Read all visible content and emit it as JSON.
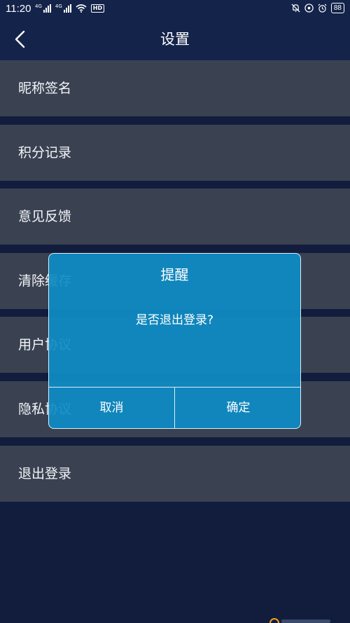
{
  "status_bar": {
    "time": "11:20",
    "signal_1_tag": "4G",
    "signal_2_tag": "4G",
    "hd_label": "HD",
    "battery": "88",
    "icons": [
      "signal-icon",
      "signal-icon",
      "wifi-icon",
      "hd-icon",
      "mute-bell-icon",
      "location-icon",
      "alarm-icon",
      "battery-icon"
    ]
  },
  "header": {
    "title": "设置",
    "back_icon": "chevron-left-icon"
  },
  "settings": {
    "items": [
      {
        "label": "昵称签名"
      },
      {
        "label": "积分记录"
      },
      {
        "label": "意见反馈"
      },
      {
        "label": "清除缓存"
      },
      {
        "label": "用户协议"
      },
      {
        "label": "隐私协议"
      },
      {
        "label": "退出登录"
      }
    ]
  },
  "dialog": {
    "title": "提醒",
    "message": "是否退出登录?",
    "cancel_label": "取消",
    "confirm_label": "确定"
  },
  "colors": {
    "background": "#121c3d",
    "header": "#14234a",
    "item": "#3a4252",
    "dialog": "#0e8cc4"
  }
}
